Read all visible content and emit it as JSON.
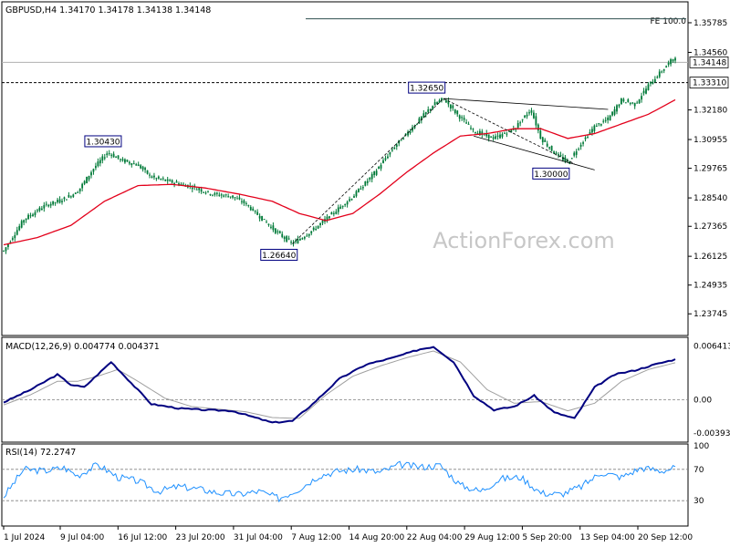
{
  "header": {
    "symbol_line": "GBPUSD,H4  1.34170 1.34178 1.34138 1.34148",
    "macd_label": "MACD(12,26,9) 0.004774 0.004371",
    "rsi_label": "RSI(14) 72.2747",
    "watermark": "ActionForex.com"
  },
  "colors": {
    "candle": "#007a38",
    "ma": "#e3001b",
    "macd_line": "#000080",
    "signal_line": "#a0a0a0",
    "rsi_line": "#1e90ff",
    "grid": "#808080"
  },
  "chart_data": [
    {
      "type": "candlestick",
      "title": "GBPUSD,H4",
      "ylim": [
        1.23,
        1.365
      ],
      "y_ticks": [
        "1.35785",
        "1.34560",
        "1.33310",
        "1.32180",
        "1.30955",
        "1.29765",
        "1.28540",
        "1.27365",
        "1.26125",
        "1.24935",
        "1.23745"
      ],
      "x_ticks": [
        "1 Jul 2024",
        "9 Jul 04:00",
        "16 Jul 12:00",
        "23 Jul 20:00",
        "31 Jul 04:00",
        "7 Aug 12:00",
        "14 Aug 20:00",
        "22 Aug 04:00",
        "29 Aug 12:00",
        "5 Sep 20:00",
        "13 Sep 04:00",
        "20 Sep 12:00"
      ],
      "last_price": "1.34148",
      "marked_level": "1.33310",
      "fe_label": "FE 100.0",
      "fe_level": 1.3595,
      "annotations": [
        {
          "text": "1.30430",
          "value": 1.3043
        },
        {
          "text": "1.26640",
          "value": 1.2664
        },
        {
          "text": "1.32650",
          "value": 1.3265
        },
        {
          "text": "1.30000",
          "value": 1.3
        }
      ],
      "price_path": [
        {
          "x": 0.0,
          "y": 1.2635
        },
        {
          "x": 0.03,
          "y": 1.2765
        },
        {
          "x": 0.06,
          "y": 1.282
        },
        {
          "x": 0.09,
          "y": 1.285
        },
        {
          "x": 0.11,
          "y": 1.288
        },
        {
          "x": 0.135,
          "y": 1.298
        },
        {
          "x": 0.155,
          "y": 1.3043
        },
        {
          "x": 0.175,
          "y": 1.301
        },
        {
          "x": 0.2,
          "y": 1.299
        },
        {
          "x": 0.22,
          "y": 1.294
        },
        {
          "x": 0.25,
          "y": 1.292
        },
        {
          "x": 0.28,
          "y": 1.29
        },
        {
          "x": 0.31,
          "y": 1.287
        },
        {
          "x": 0.34,
          "y": 1.286
        },
        {
          "x": 0.36,
          "y": 1.283
        },
        {
          "x": 0.38,
          "y": 1.278
        },
        {
          "x": 0.405,
          "y": 1.2715
        },
        {
          "x": 0.43,
          "y": 1.2664
        },
        {
          "x": 0.46,
          "y": 1.272
        },
        {
          "x": 0.49,
          "y": 1.279
        },
        {
          "x": 0.52,
          "y": 1.286
        },
        {
          "x": 0.55,
          "y": 1.295
        },
        {
          "x": 0.58,
          "y": 1.306
        },
        {
          "x": 0.61,
          "y": 1.315
        },
        {
          "x": 0.64,
          "y": 1.324
        },
        {
          "x": 0.655,
          "y": 1.3265
        },
        {
          "x": 0.675,
          "y": 1.32
        },
        {
          "x": 0.7,
          "y": 1.313
        },
        {
          "x": 0.73,
          "y": 1.31
        },
        {
          "x": 0.76,
          "y": 1.314
        },
        {
          "x": 0.785,
          "y": 1.322
        },
        {
          "x": 0.8,
          "y": 1.31
        },
        {
          "x": 0.82,
          "y": 1.304
        },
        {
          "x": 0.84,
          "y": 1.3
        },
        {
          "x": 0.86,
          "y": 1.308
        },
        {
          "x": 0.88,
          "y": 1.315
        },
        {
          "x": 0.9,
          "y": 1.318
        },
        {
          "x": 0.92,
          "y": 1.326
        },
        {
          "x": 0.94,
          "y": 1.324
        },
        {
          "x": 0.96,
          "y": 1.332
        },
        {
          "x": 0.98,
          "y": 1.338
        },
        {
          "x": 1.0,
          "y": 1.344
        }
      ],
      "ma_path": [
        {
          "x": 0.0,
          "y": 1.266
        },
        {
          "x": 0.05,
          "y": 1.269
        },
        {
          "x": 0.1,
          "y": 1.274
        },
        {
          "x": 0.15,
          "y": 1.284
        },
        {
          "x": 0.2,
          "y": 1.2905
        },
        {
          "x": 0.25,
          "y": 1.291
        },
        {
          "x": 0.3,
          "y": 1.2895
        },
        {
          "x": 0.35,
          "y": 1.287
        },
        {
          "x": 0.4,
          "y": 1.284
        },
        {
          "x": 0.44,
          "y": 1.279
        },
        {
          "x": 0.48,
          "y": 1.276
        },
        {
          "x": 0.52,
          "y": 1.279
        },
        {
          "x": 0.56,
          "y": 1.287
        },
        {
          "x": 0.6,
          "y": 1.296
        },
        {
          "x": 0.64,
          "y": 1.304
        },
        {
          "x": 0.68,
          "y": 1.311
        },
        {
          "x": 0.72,
          "y": 1.312
        },
        {
          "x": 0.76,
          "y": 1.314
        },
        {
          "x": 0.8,
          "y": 1.314
        },
        {
          "x": 0.84,
          "y": 1.31
        },
        {
          "x": 0.88,
          "y": 1.312
        },
        {
          "x": 0.92,
          "y": 1.316
        },
        {
          "x": 0.96,
          "y": 1.32
        },
        {
          "x": 1.0,
          "y": 1.326
        }
      ]
    },
    {
      "type": "line",
      "title": "MACD(12,26,9)",
      "ylim": [
        -0.0048,
        0.0072
      ],
      "y_ticks": [
        "0.006413",
        "0.00",
        "-0.003938"
      ],
      "series": [
        {
          "name": "MACD",
          "values": [
            {
              "x": 0.0,
              "y": -0.0003
            },
            {
              "x": 0.04,
              "y": 0.0012
            },
            {
              "x": 0.08,
              "y": 0.003
            },
            {
              "x": 0.1,
              "y": 0.0018
            },
            {
              "x": 0.12,
              "y": 0.0015
            },
            {
              "x": 0.16,
              "y": 0.0045
            },
            {
              "x": 0.19,
              "y": 0.002
            },
            {
              "x": 0.22,
              "y": -0.0005
            },
            {
              "x": 0.26,
              "y": -0.001
            },
            {
              "x": 0.3,
              "y": -0.0012
            },
            {
              "x": 0.34,
              "y": -0.0013
            },
            {
              "x": 0.37,
              "y": -0.002
            },
            {
              "x": 0.4,
              "y": -0.0027
            },
            {
              "x": 0.43,
              "y": -0.0025
            },
            {
              "x": 0.46,
              "y": -0.0005
            },
            {
              "x": 0.5,
              "y": 0.0025
            },
            {
              "x": 0.54,
              "y": 0.0042
            },
            {
              "x": 0.58,
              "y": 0.005
            },
            {
              "x": 0.62,
              "y": 0.006
            },
            {
              "x": 0.64,
              "y": 0.0063
            },
            {
              "x": 0.67,
              "y": 0.0045
            },
            {
              "x": 0.7,
              "y": 0.0005
            },
            {
              "x": 0.73,
              "y": -0.0012
            },
            {
              "x": 0.76,
              "y": -0.0008
            },
            {
              "x": 0.79,
              "y": 0.0005
            },
            {
              "x": 0.82,
              "y": -0.0015
            },
            {
              "x": 0.85,
              "y": -0.0022
            },
            {
              "x": 0.88,
              "y": 0.0015
            },
            {
              "x": 0.91,
              "y": 0.003
            },
            {
              "x": 0.94,
              "y": 0.0035
            },
            {
              "x": 0.97,
              "y": 0.0042
            },
            {
              "x": 1.0,
              "y": 0.0048
            }
          ]
        },
        {
          "name": "Signal",
          "values": [
            {
              "x": 0.0,
              "y": -0.0006
            },
            {
              "x": 0.04,
              "y": 0.0006
            },
            {
              "x": 0.08,
              "y": 0.0022
            },
            {
              "x": 0.11,
              "y": 0.0022
            },
            {
              "x": 0.14,
              "y": 0.0028
            },
            {
              "x": 0.17,
              "y": 0.0036
            },
            {
              "x": 0.2,
              "y": 0.0022
            },
            {
              "x": 0.24,
              "y": 0.0002
            },
            {
              "x": 0.28,
              "y": -0.0008
            },
            {
              "x": 0.32,
              "y": -0.0011
            },
            {
              "x": 0.36,
              "y": -0.0014
            },
            {
              "x": 0.4,
              "y": -0.0021
            },
            {
              "x": 0.44,
              "y": -0.0022
            },
            {
              "x": 0.48,
              "y": 0.0006
            },
            {
              "x": 0.52,
              "y": 0.0028
            },
            {
              "x": 0.56,
              "y": 0.004
            },
            {
              "x": 0.6,
              "y": 0.005
            },
            {
              "x": 0.64,
              "y": 0.0058
            },
            {
              "x": 0.68,
              "y": 0.0045
            },
            {
              "x": 0.72,
              "y": 0.0012
            },
            {
              "x": 0.76,
              "y": -0.0004
            },
            {
              "x": 0.8,
              "y": -0.0002
            },
            {
              "x": 0.84,
              "y": -0.0013
            },
            {
              "x": 0.88,
              "y": -0.0004
            },
            {
              "x": 0.92,
              "y": 0.0022
            },
            {
              "x": 0.96,
              "y": 0.0036
            },
            {
              "x": 1.0,
              "y": 0.0044
            }
          ]
        }
      ]
    },
    {
      "type": "line",
      "title": "RSI(14)",
      "ylim": [
        0,
        100
      ],
      "y_ticks": [
        "100",
        "70",
        "30",
        "0"
      ],
      "series": [
        {
          "name": "RSI",
          "values": [
            {
              "x": 0.0,
              "y": 35
            },
            {
              "x": 0.03,
              "y": 70
            },
            {
              "x": 0.06,
              "y": 68
            },
            {
              "x": 0.09,
              "y": 72
            },
            {
              "x": 0.11,
              "y": 62
            },
            {
              "x": 0.14,
              "y": 76
            },
            {
              "x": 0.17,
              "y": 60
            },
            {
              "x": 0.2,
              "y": 55
            },
            {
              "x": 0.23,
              "y": 42
            },
            {
              "x": 0.26,
              "y": 48
            },
            {
              "x": 0.29,
              "y": 45
            },
            {
              "x": 0.32,
              "y": 40
            },
            {
              "x": 0.35,
              "y": 38
            },
            {
              "x": 0.38,
              "y": 42
            },
            {
              "x": 0.41,
              "y": 33
            },
            {
              "x": 0.44,
              "y": 45
            },
            {
              "x": 0.47,
              "y": 62
            },
            {
              "x": 0.5,
              "y": 68
            },
            {
              "x": 0.53,
              "y": 70
            },
            {
              "x": 0.56,
              "y": 66
            },
            {
              "x": 0.59,
              "y": 76
            },
            {
              "x": 0.62,
              "y": 73
            },
            {
              "x": 0.65,
              "y": 75
            },
            {
              "x": 0.68,
              "y": 50
            },
            {
              "x": 0.71,
              "y": 42
            },
            {
              "x": 0.74,
              "y": 58
            },
            {
              "x": 0.77,
              "y": 60
            },
            {
              "x": 0.8,
              "y": 40
            },
            {
              "x": 0.83,
              "y": 38
            },
            {
              "x": 0.86,
              "y": 48
            },
            {
              "x": 0.89,
              "y": 66
            },
            {
              "x": 0.92,
              "y": 60
            },
            {
              "x": 0.95,
              "y": 72
            },
            {
              "x": 0.98,
              "y": 68
            },
            {
              "x": 1.0,
              "y": 72
            }
          ]
        }
      ]
    }
  ]
}
